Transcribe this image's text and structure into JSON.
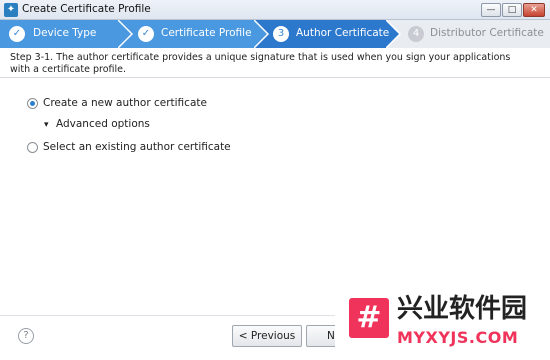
{
  "window": {
    "title": "Create Certificate Profile",
    "icon": "tizen-app-icon",
    "controls": {
      "minimize": "—",
      "maximize": "□",
      "close": "✕"
    }
  },
  "steps": [
    {
      "label": "Device Type",
      "state": "done",
      "marker": "✓"
    },
    {
      "label": "Certificate Profile",
      "state": "done",
      "marker": "✓"
    },
    {
      "label": "Author Certificate",
      "state": "current",
      "marker": "3"
    },
    {
      "label": "Distributor Certificate",
      "state": "todo",
      "marker": "4"
    }
  ],
  "colors": {
    "done_step": "#4a98e0",
    "current_step": "#2c78cc",
    "todo_step": "#e9ecf0",
    "accent": "#2b7fd0"
  },
  "description": "Step 3-1. The author certificate provides a unique signature that is used when you sign your applications with a certificate profile.",
  "options": {
    "create_new": {
      "label": "Create a new author certificate",
      "checked": true
    },
    "advanced": {
      "label": "Advanced options",
      "icon": "chevron-down-icon"
    },
    "select_existing": {
      "label": "Select an existing author certificate",
      "checked": false
    }
  },
  "footer": {
    "help": "?",
    "previous_label": "< Previous",
    "next_label": "N"
  },
  "watermark": {
    "logo_glyph": "#",
    "title": "兴业软件园",
    "subtitle": "MYXYJS.COM"
  }
}
